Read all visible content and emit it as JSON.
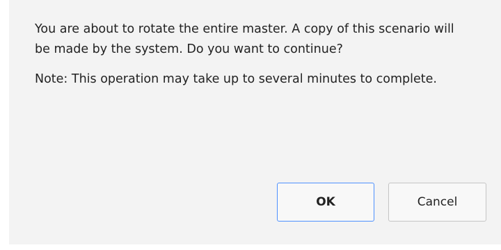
{
  "dialog": {
    "message_line_1": "You are about to rotate the entire master. A copy of this scenario will be made by the system. Do you want to continue?",
    "message_line_2": "Note: This operation may take up to several minutes to complete.",
    "ok_label": "OK",
    "cancel_label": "Cancel",
    "focus_color": "#4d90fe",
    "background_color": "#f3f3f3"
  }
}
